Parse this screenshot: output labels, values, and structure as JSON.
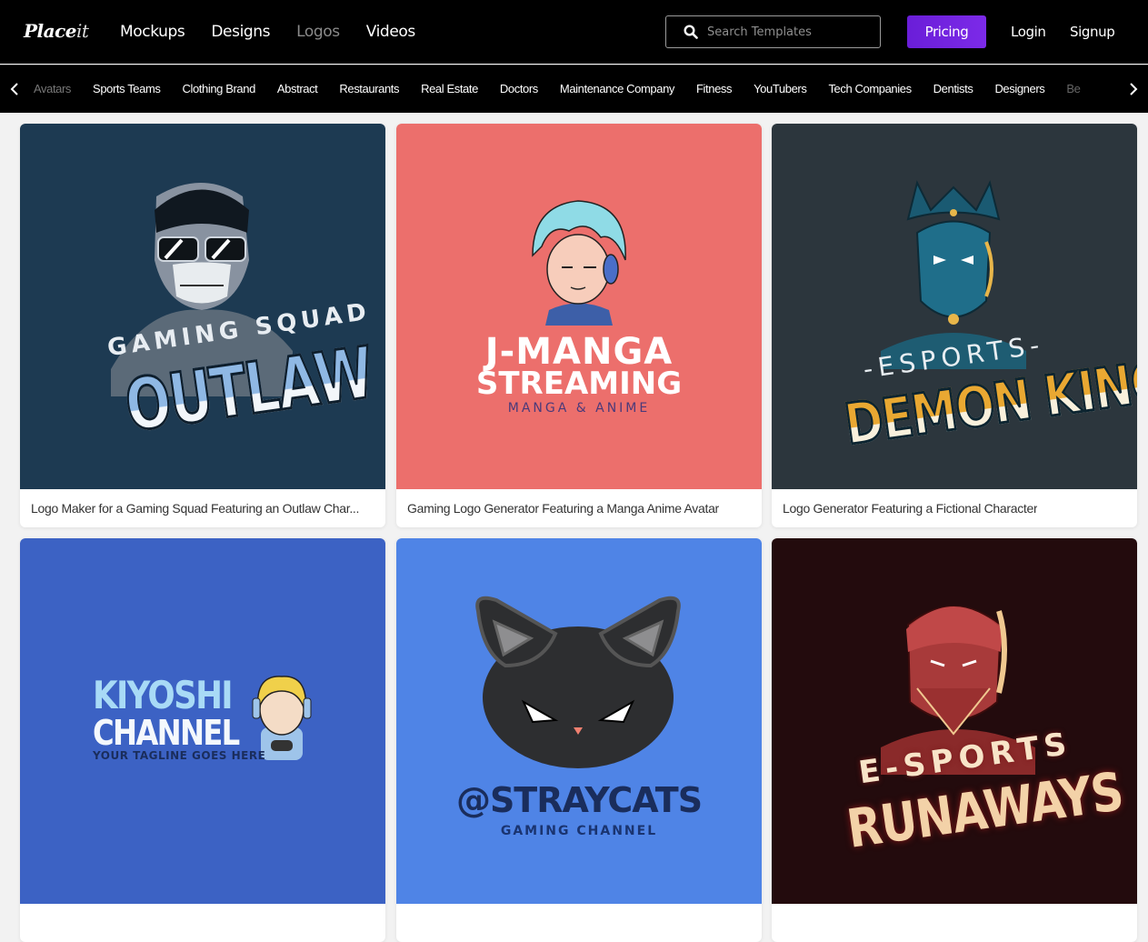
{
  "header": {
    "logo_main": "Place",
    "logo_suffix": "it",
    "nav": [
      {
        "label": "Mockups",
        "active": false
      },
      {
        "label": "Designs",
        "active": false
      },
      {
        "label": "Logos",
        "active": true
      },
      {
        "label": "Videos",
        "active": false
      }
    ],
    "search": {
      "placeholder": "Search Templates",
      "value": "",
      "icon": "search-icon"
    },
    "pricing_label": "Pricing",
    "login_label": "Login",
    "signup_label": "Signup",
    "accent_color": "#6f22de"
  },
  "categories": {
    "prev_icon": "chevron-left-icon",
    "next_icon": "chevron-right-icon",
    "items": [
      "Avatars",
      "Sports Teams",
      "Clothing Brand",
      "Abstract",
      "Restaurants",
      "Real Estate",
      "Doctors",
      "Maintenance Company",
      "Fitness",
      "YouTubers",
      "Tech Companies",
      "Dentists",
      "Designers",
      "Be"
    ]
  },
  "cards": [
    {
      "caption": "Logo Maker for a Gaming Squad Featuring an Outlaw Char...",
      "bg_color": "#1d3a52",
      "logo": {
        "line1": "GAMING SQUAD",
        "line2": "OUTLAW",
        "character": "skull-mask-outlaw"
      }
    },
    {
      "caption": "Gaming Logo Generator Featuring a Manga Anime Avatar",
      "bg_color": "#ec6f6c",
      "logo": {
        "line1": "J-MANGA",
        "line2": "STREAMING",
        "line3": "MANGA & ANIME",
        "character": "manga-avatar"
      }
    },
    {
      "caption": "Logo Generator Featuring a Fictional Character",
      "bg_color": "#2c363d",
      "logo": {
        "line1": "-ESPORTS-",
        "line2": "DEMON KING",
        "character": "demon-king"
      }
    },
    {
      "caption": "",
      "bg_color": "#3c62c4",
      "logo": {
        "line1": "KIYOSHI",
        "line2": "CHANNEL",
        "line3": "YOUR TAGLINE GOES HERE",
        "character": "blonde-gamer"
      }
    },
    {
      "caption": "",
      "bg_color": "#4f84e6",
      "logo": {
        "line1": "@STRAYCATS",
        "line2": "GAMING CHANNEL",
        "character": "black-cat"
      }
    },
    {
      "caption": "",
      "bg_color": "#230b0d",
      "logo": {
        "line1": "E-SPORTS",
        "line2": "RUNAWAYS",
        "character": "masked-runaway"
      }
    }
  ]
}
